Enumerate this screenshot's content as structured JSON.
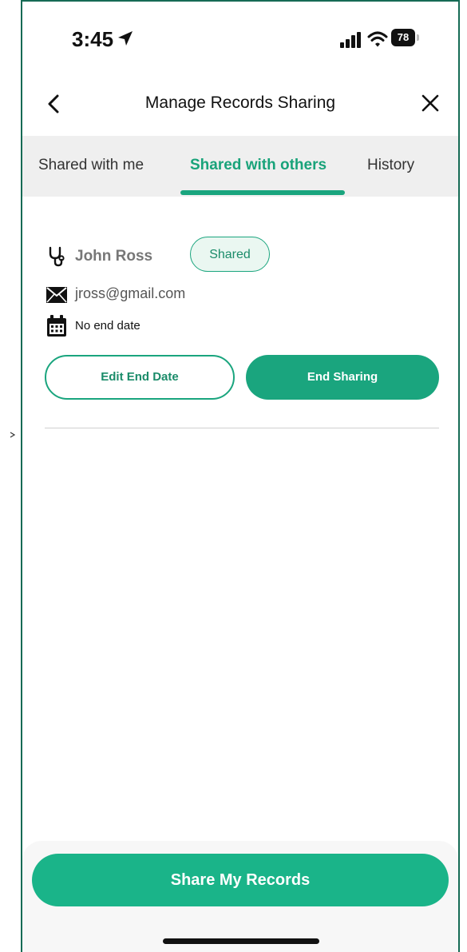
{
  "status_bar": {
    "time": "3:45",
    "battery": "78",
    "location_icon": "location-arrow-icon",
    "signal_icon": "cellular-signal-icon",
    "wifi_icon": "wifi-icon"
  },
  "header": {
    "title": "Manage Records Sharing",
    "back_icon": "chevron-left-icon",
    "close_icon": "close-icon"
  },
  "tabs": [
    {
      "label": "Shared with me",
      "active": false
    },
    {
      "label": "Shared with others",
      "active": true
    },
    {
      "label": "History",
      "active": false
    }
  ],
  "share_entry": {
    "name": "John Ross",
    "status": "Shared",
    "email": "jross@gmail.com",
    "end_date": "No end date",
    "edit_button": "Edit End Date",
    "end_button": "End Sharing"
  },
  "footer": {
    "share_button": "Share My Records"
  },
  "colors": {
    "accent": "#1aa57e",
    "accent_light": "#eaf7f1",
    "tab_bg": "#efefef"
  }
}
